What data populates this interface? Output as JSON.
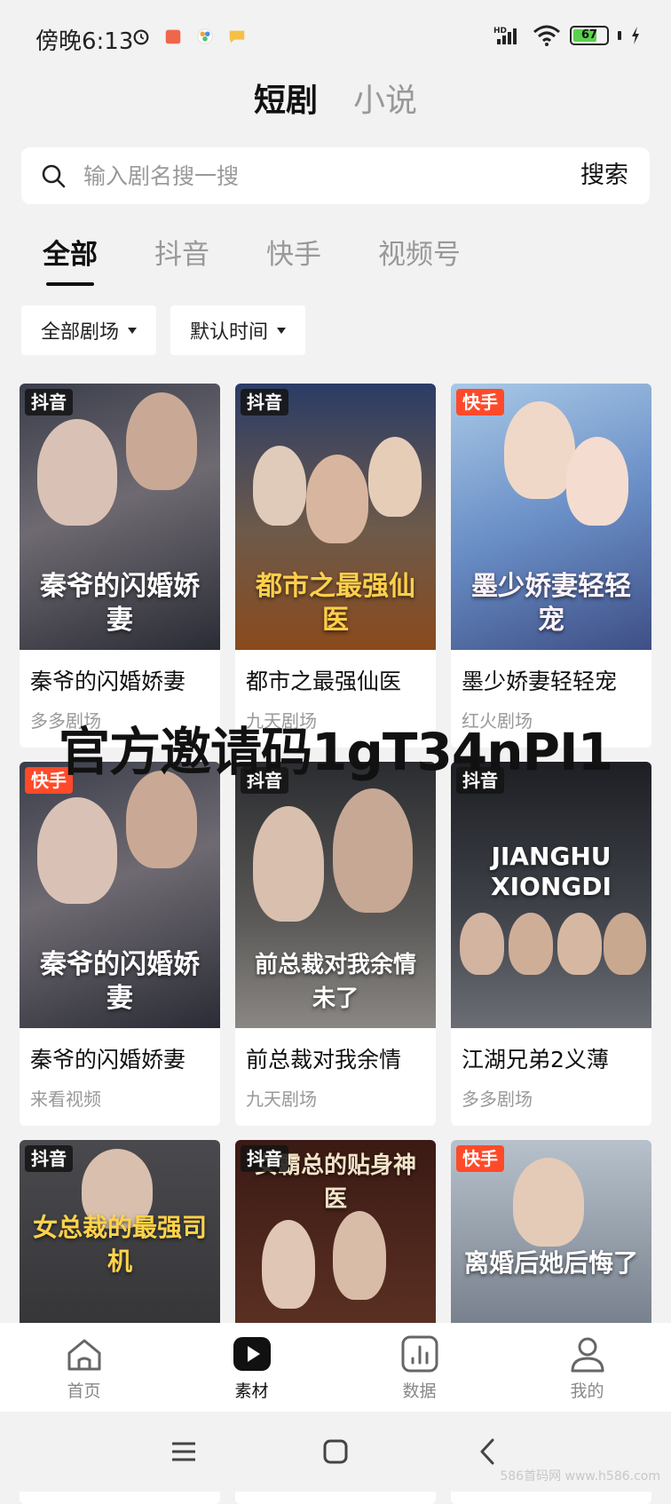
{
  "status_bar": {
    "time": "傍晚6:13",
    "battery_level": "67",
    "icons": [
      "alarm-icon",
      "shop-app-icon",
      "photos-app-icon",
      "message-app-icon",
      "hd-signal-icon",
      "wifi-icon",
      "battery-icon",
      "charging-icon"
    ]
  },
  "top_tabs": [
    {
      "label": "短剧",
      "active": true
    },
    {
      "label": "小说",
      "active": false
    }
  ],
  "search": {
    "placeholder": "输入剧名搜一搜",
    "button_label": "搜索"
  },
  "platform_tabs": [
    {
      "label": "全部",
      "active": true
    },
    {
      "label": "抖音",
      "active": false
    },
    {
      "label": "快手",
      "active": false
    },
    {
      "label": "视频号",
      "active": false
    }
  ],
  "filters": {
    "theater": "全部剧场",
    "sort": "默认时间"
  },
  "cards": [
    {
      "badge": "抖音",
      "title": "秦爷的闪婚娇妻",
      "source": "多多剧场",
      "cover_text": "秦爷的闪婚娇妻"
    },
    {
      "badge": "抖音",
      "title": "都市之最强仙医",
      "source": "九天剧场",
      "cover_text": "都市之最强仙医"
    },
    {
      "badge": "快手",
      "title": "墨少娇妻轻轻宠",
      "source": "红火剧场",
      "cover_text": "墨少娇妻轻轻宠"
    },
    {
      "badge": "快手",
      "title": "秦爷的闪婚娇妻",
      "source": "来看视频",
      "cover_text": "秦爷的闪婚娇妻"
    },
    {
      "badge": "抖音",
      "title": "前总裁对我余情",
      "source": "九天剧场",
      "cover_text": "前总裁对我余情未了"
    },
    {
      "badge": "抖音",
      "title": "江湖兄弟2义薄",
      "source": "多多剧场",
      "cover_text": "JIANGHU XIONGDI"
    },
    {
      "badge": "抖音",
      "title": "",
      "source": "",
      "cover_text": "女总裁的最强司机"
    },
    {
      "badge": "抖音",
      "title": "",
      "source": "",
      "cover_text": "女霸总的贴身神医"
    },
    {
      "badge": "快手",
      "title": "",
      "source": "",
      "cover_text": "离婚后她后悔了"
    }
  ],
  "watermark": "官方邀请码1gT34nPI1",
  "bottom_nav": [
    {
      "label": "首页",
      "icon": "home-icon",
      "active": false
    },
    {
      "label": "素材",
      "icon": "play-icon",
      "active": true
    },
    {
      "label": "数据",
      "icon": "chart-icon",
      "active": false
    },
    {
      "label": "我的",
      "icon": "profile-icon",
      "active": false
    }
  ],
  "site_mark": "586首码网 www.h586.com",
  "colors": {
    "background": "#f2f2f2",
    "kuaishou_badge": "#ff4a2a",
    "douyin_badge": "#1a1a1a",
    "battery": "#5ad14c"
  }
}
